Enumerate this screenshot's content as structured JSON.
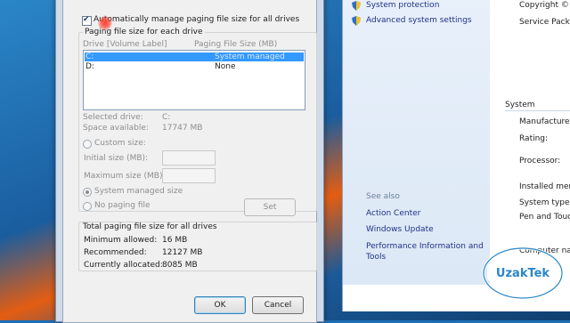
{
  "dialog": {
    "auto_manage_label": "Automatically manage paging file size for all drives",
    "auto_manage_checked": true,
    "paging_group_title": "Paging file size for each drive",
    "list_header_drive": "Drive  [Volume Label]",
    "list_header_size": "Paging File Size (MB)",
    "drives": [
      {
        "drive": "C:",
        "size": "System managed",
        "selected": true
      },
      {
        "drive": "D:",
        "size": "None",
        "selected": false
      }
    ],
    "selected_drive_label": "Selected drive:",
    "selected_drive_value": "C:",
    "space_available_label": "Space available:",
    "space_available_value": "17747 MB",
    "custom_size_label": "Custom size:",
    "initial_size_label": "Initial size (MB):",
    "maximum_size_label": "Maximum size (MB):",
    "system_managed_label": "System managed size",
    "no_paging_label": "No paging file",
    "set_button": "Set",
    "total_group_title": "Total paging file size for all drives",
    "min_allowed_label": "Minimum allowed:",
    "min_allowed_value": "16 MB",
    "recommended_label": "Recommended:",
    "recommended_value": "12127 MB",
    "allocated_label": "Currently allocated:",
    "allocated_value": "8085 MB",
    "ok_button": "OK",
    "cancel_button": "Cancel"
  },
  "system_panel": {
    "nav_links": [
      "System protection",
      "Advanced system settings"
    ],
    "see_also_title": "See also",
    "see_also_links": [
      "Action Center",
      "Windows Update",
      "Performance Information and Tools"
    ],
    "right_texts": [
      "Copyright ©",
      "Service Pack",
      "System",
      "Manufacturer",
      "Rating:",
      "Processor:",
      "Installed mem",
      "System type:",
      "Pen and Touc",
      "Computer name"
    ]
  },
  "watermark": {
    "text": "UzakTek"
  },
  "colors": {
    "accent": "#3399ff",
    "link": "#1e3287",
    "brand": "#2a86c8"
  }
}
